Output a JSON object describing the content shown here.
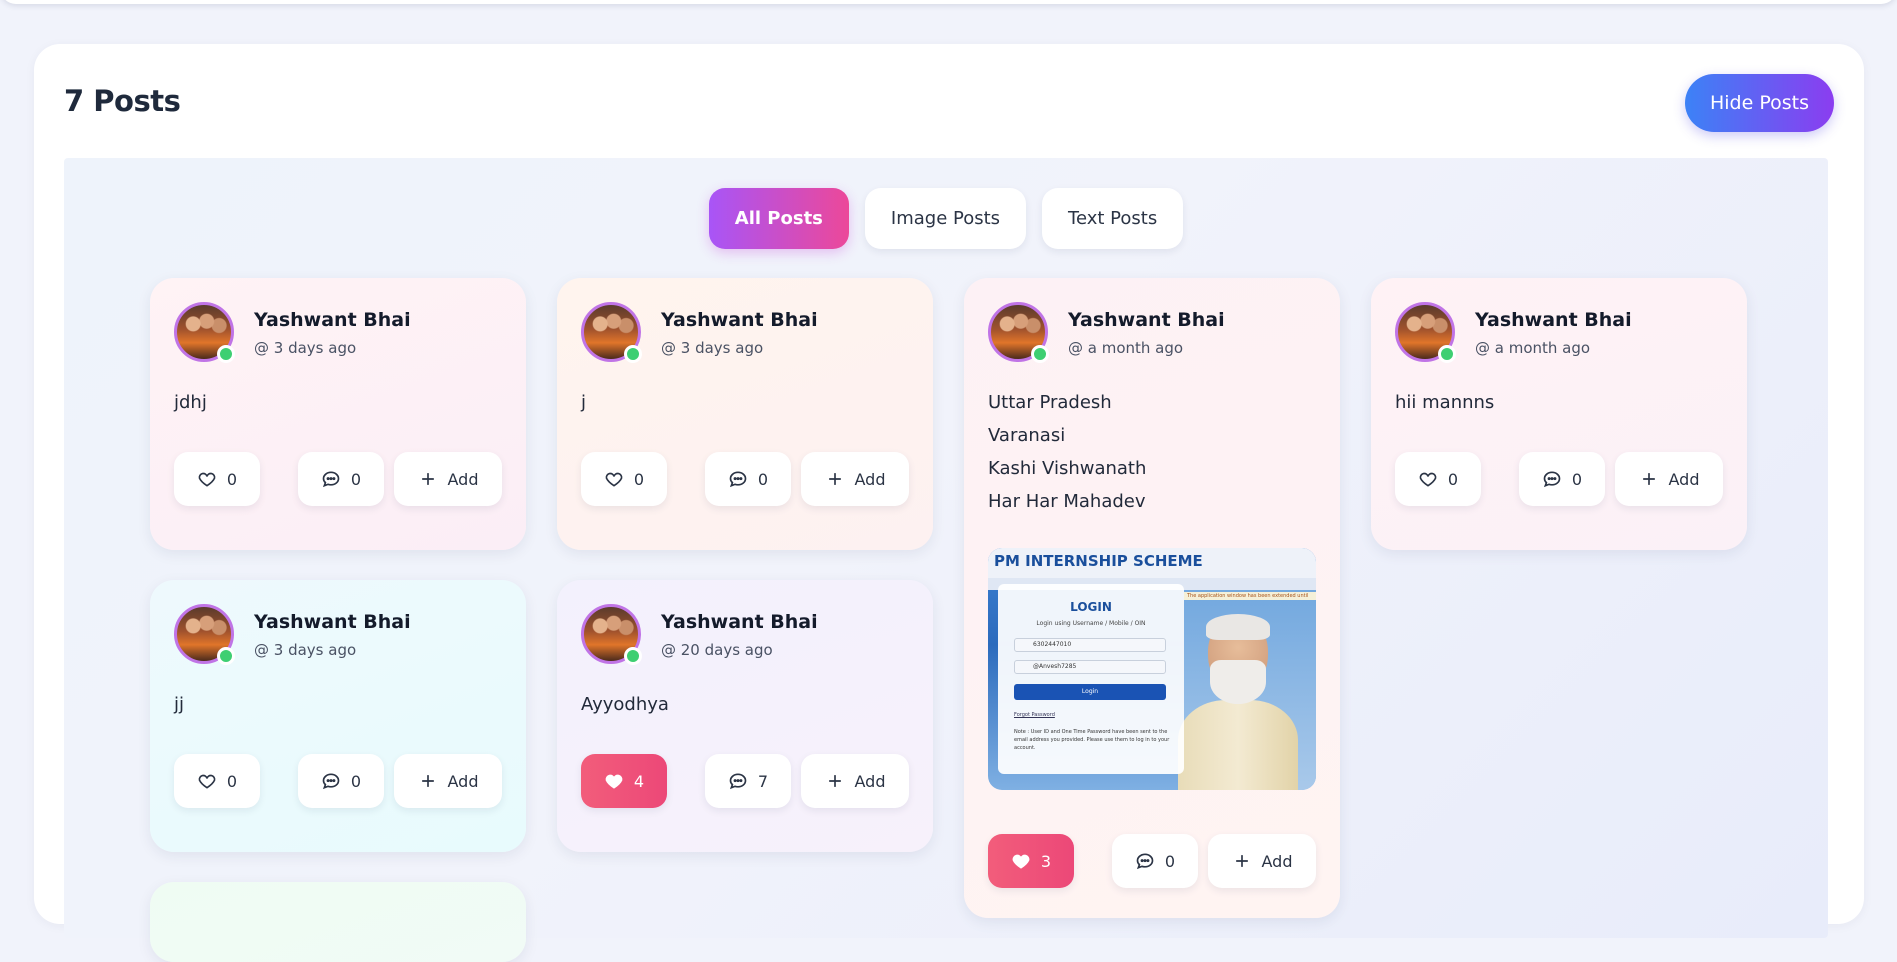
{
  "header": {
    "title": "7 Posts",
    "hide_label": "Hide Posts"
  },
  "filters": [
    {
      "label": "All Posts",
      "active": true
    },
    {
      "label": "Image Posts",
      "active": false
    },
    {
      "label": "Text Posts",
      "active": false
    }
  ],
  "posts": [
    {
      "author": "Yashwant Bhai",
      "time": "@ 3 days ago",
      "text": "jdhj",
      "likes": "0",
      "comments": "0",
      "add_label": "Add",
      "liked": false
    },
    {
      "author": "Yashwant Bhai",
      "time": "@ 3 days ago",
      "text": "j",
      "likes": "0",
      "comments": "0",
      "add_label": "Add",
      "liked": false
    },
    {
      "author": "Yashwant Bhai",
      "time": "@ a month ago",
      "text_lines": [
        "Uttar Pradesh",
        "Varanasi",
        "Kashi Vishwanath",
        "Har Har Mahadev"
      ],
      "likes": "3",
      "comments": "0",
      "add_label": "Add",
      "liked": true,
      "image": {
        "title": "PM INTERNSHIP SCHEME",
        "login": "LOGIN",
        "subtitle": "Login using Username / Mobile / OIN",
        "username": "6302447010",
        "password": "@Anvesh7285",
        "button": "Login",
        "forgot": "Forgot Password",
        "note": "Note : User ID and One Time Password have been sent to the email address you provided. Please use them to log in to your account.",
        "ticker": "The application window has been extended until"
      }
    },
    {
      "author": "Yashwant Bhai",
      "time": "@ a month ago",
      "text": "hii mannns",
      "likes": "0",
      "comments": "0",
      "add_label": "Add",
      "liked": false
    },
    {
      "author": "Yashwant Bhai",
      "time": "@ 3 days ago",
      "text": "jj",
      "likes": "0",
      "comments": "0",
      "add_label": "Add",
      "liked": false
    },
    {
      "author": "Yashwant Bhai",
      "time": "@ 20 days ago",
      "text": "Ayyodhya",
      "likes": "4",
      "comments": "7",
      "add_label": "Add",
      "liked": true
    }
  ],
  "colors": {
    "accent_gradient_start": "#a855f7",
    "accent_gradient_end": "#ec4899",
    "hide_gradient_start": "#3c82f6",
    "hide_gradient_end": "#8b3df0",
    "liked": "#f25d7b",
    "online": "#3ecf72"
  },
  "icons": [
    "heart-icon",
    "comment-icon",
    "plus-icon",
    "online-indicator"
  ]
}
